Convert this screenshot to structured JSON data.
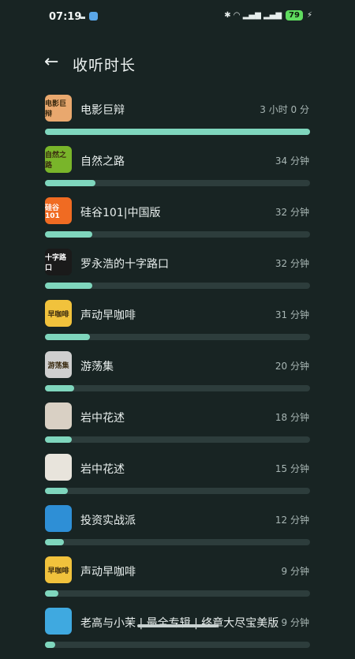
{
  "status": {
    "time": "07:19",
    "battery": "79",
    "right_glyphs": "✱ ◠ ▂▄▆ ▂▄▆"
  },
  "header": {
    "back_icon": "left-arrow-icon",
    "title": "收听时长"
  },
  "items": [
    {
      "title": "电影巨辩",
      "duration": "3 小时 0 分",
      "fraction": 1.0,
      "cover_color": "#e9a86e",
      "cover_text": "电影巨辩"
    },
    {
      "title": "自然之路",
      "duration": "34 分钟",
      "fraction": 0.19,
      "cover_color": "#79b52a",
      "cover_text": "自然之路"
    },
    {
      "title": "硅谷101|中国版",
      "duration": "32 分钟",
      "fraction": 0.18,
      "cover_color": "#f06b22",
      "cover_text": "硅谷101"
    },
    {
      "title": "罗永浩的十字路口",
      "duration": "32 分钟",
      "fraction": 0.18,
      "cover_color": "#1a1a1a",
      "cover_text": "十字路口"
    },
    {
      "title": "声动早咖啡",
      "duration": "31 分钟",
      "fraction": 0.17,
      "cover_color": "#f1c23c",
      "cover_text": "早咖啡"
    },
    {
      "title": "游荡集",
      "duration": "20 分钟",
      "fraction": 0.11,
      "cover_color": "#cfcfcf",
      "cover_text": "游荡集"
    },
    {
      "title": "岩中花述",
      "duration": "18 分钟",
      "fraction": 0.1,
      "cover_color": "#d9d0c4",
      "cover_text": ""
    },
    {
      "title": "岩中花述",
      "duration": "15 分钟",
      "fraction": 0.085,
      "cover_color": "#e8e4dc",
      "cover_text": ""
    },
    {
      "title": "投资实战派",
      "duration": "12 分钟",
      "fraction": 0.07,
      "cover_color": "#2e8fd6",
      "cover_text": ""
    },
    {
      "title": "声动早咖啡",
      "duration": "9 分钟",
      "fraction": 0.05,
      "cover_color": "#f1c23c",
      "cover_text": "早咖啡"
    },
    {
      "title": "老高与小茉 | 最全专辑 | 终章大尽宝美版",
      "duration": "9 分钟",
      "fraction": 0.04,
      "cover_color": "#3fa9e0",
      "cover_text": ""
    }
  ]
}
